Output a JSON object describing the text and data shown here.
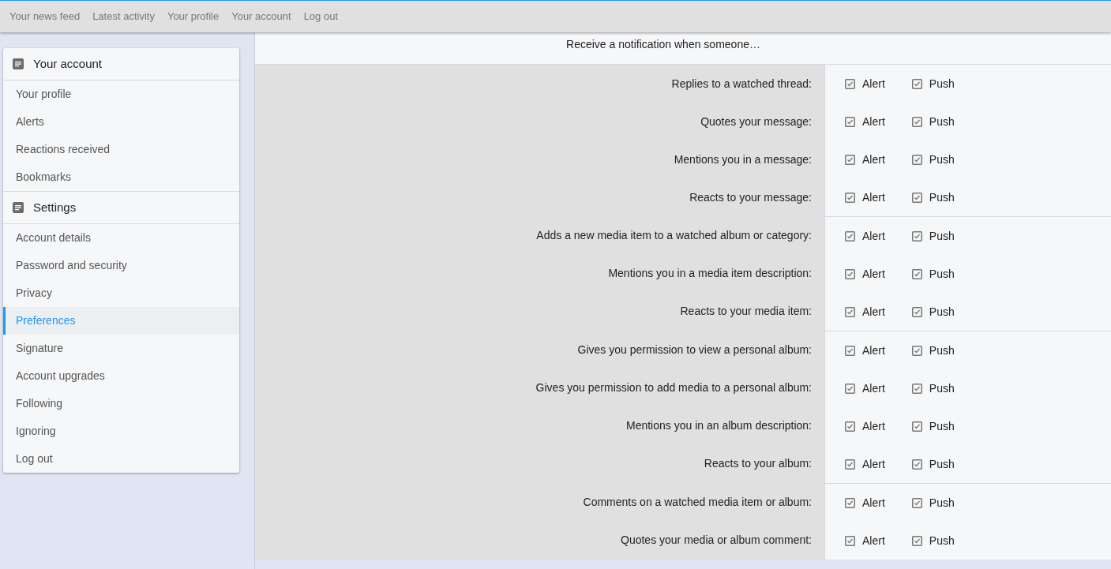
{
  "top_nav": [
    {
      "label": "Your news feed"
    },
    {
      "label": "Latest activity"
    },
    {
      "label": "Your profile"
    },
    {
      "label": "Your account"
    },
    {
      "label": "Log out"
    }
  ],
  "sidebar": {
    "sections": [
      {
        "title": "Your account",
        "items": [
          {
            "label": "Your profile",
            "selected": false
          },
          {
            "label": "Alerts",
            "selected": false
          },
          {
            "label": "Reactions received",
            "selected": false
          },
          {
            "label": "Bookmarks",
            "selected": false
          }
        ]
      },
      {
        "title": "Settings",
        "items": [
          {
            "label": "Account details",
            "selected": false
          },
          {
            "label": "Password and security",
            "selected": false
          },
          {
            "label": "Privacy",
            "selected": false
          },
          {
            "label": "Preferences",
            "selected": true
          },
          {
            "label": "Signature",
            "selected": false
          },
          {
            "label": "Account upgrades",
            "selected": false
          },
          {
            "label": "Following",
            "selected": false
          },
          {
            "label": "Ignoring",
            "selected": false
          },
          {
            "label": "Log out",
            "selected": false
          }
        ]
      }
    ]
  },
  "notifications": {
    "heading": "Receive a notification when someone…",
    "groups": [
      {
        "rows": [
          {
            "label": "Replies to a watched thread:",
            "options": [
              {
                "label": "Alert",
                "checked": true
              },
              {
                "label": "Push",
                "checked": true
              }
            ]
          },
          {
            "label": "Quotes your message:",
            "options": [
              {
                "label": "Alert",
                "checked": true
              },
              {
                "label": "Push",
                "checked": true
              }
            ]
          },
          {
            "label": "Mentions you in a message:",
            "options": [
              {
                "label": "Alert",
                "checked": true
              },
              {
                "label": "Push",
                "checked": true
              }
            ]
          },
          {
            "label": "Reacts to your message:",
            "options": [
              {
                "label": "Alert",
                "checked": true
              },
              {
                "label": "Push",
                "checked": true
              }
            ]
          }
        ]
      },
      {
        "rows": [
          {
            "label": "Adds a new media item to a watched album or category:",
            "options": [
              {
                "label": "Alert",
                "checked": true
              },
              {
                "label": "Push",
                "checked": true
              }
            ]
          },
          {
            "label": "Mentions you in a media item description:",
            "options": [
              {
                "label": "Alert",
                "checked": true
              },
              {
                "label": "Push",
                "checked": true
              }
            ]
          },
          {
            "label": "Reacts to your media item:",
            "options": [
              {
                "label": "Alert",
                "checked": true
              },
              {
                "label": "Push",
                "checked": true
              }
            ]
          }
        ]
      },
      {
        "rows": [
          {
            "label": "Gives you permission to view a personal album:",
            "options": [
              {
                "label": "Alert",
                "checked": true
              },
              {
                "label": "Push",
                "checked": true
              }
            ]
          },
          {
            "label": "Gives you permission to add media to a personal album:",
            "options": [
              {
                "label": "Alert",
                "checked": true
              },
              {
                "label": "Push",
                "checked": true
              }
            ]
          },
          {
            "label": "Mentions you in an album description:",
            "options": [
              {
                "label": "Alert",
                "checked": true
              },
              {
                "label": "Push",
                "checked": true
              }
            ]
          },
          {
            "label": "Reacts to your album:",
            "options": [
              {
                "label": "Alert",
                "checked": true
              },
              {
                "label": "Push",
                "checked": true
              }
            ]
          }
        ]
      },
      {
        "rows": [
          {
            "label": "Comments on a watched media item or album:",
            "options": [
              {
                "label": "Alert",
                "checked": true
              },
              {
                "label": "Push",
                "checked": true
              }
            ]
          },
          {
            "label": "Quotes your media or album comment:",
            "options": [
              {
                "label": "Alert",
                "checked": true
              },
              {
                "label": "Push",
                "checked": true
              }
            ]
          }
        ]
      }
    ]
  }
}
